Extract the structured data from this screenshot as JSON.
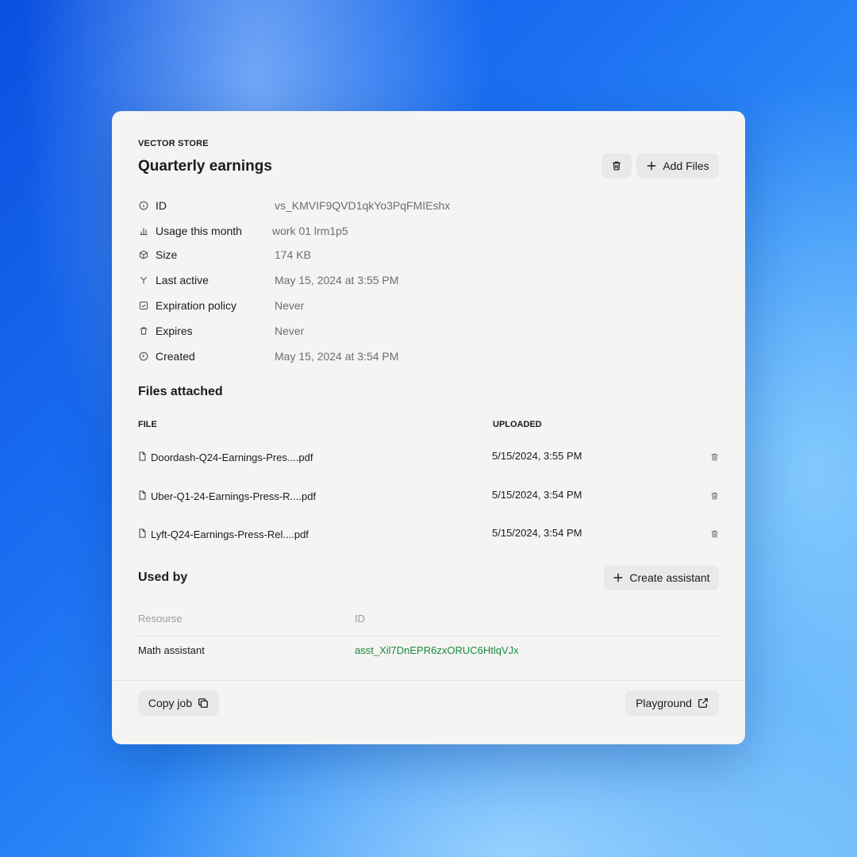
{
  "header": {
    "eyebrow": "VECTOR STORE",
    "title": "Quarterly earnings",
    "add_files_label": "Add Files"
  },
  "meta": [
    {
      "icon": "info-icon",
      "label": "ID",
      "value": "vs_KMVIF9QVD1qkYo3PqFMIEshx"
    },
    {
      "icon": "chart-icon",
      "label": "Usage this month",
      "value": "work 01 lrm1p5"
    },
    {
      "icon": "cube-icon",
      "label": "Size",
      "value": "174 KB"
    },
    {
      "icon": "activity-icon",
      "label": "Last active",
      "value": "May 15, 2024 at 3:55 PM"
    },
    {
      "icon": "calendar-check-icon",
      "label": "Expiration policy",
      "value": "Never"
    },
    {
      "icon": "trash-icon",
      "label": "Expires",
      "value": "Never"
    },
    {
      "icon": "clock-icon",
      "label": "Created",
      "value": "May 15, 2024 at 3:54 PM"
    }
  ],
  "files": {
    "title": "Files attached",
    "col_file": "FILE",
    "col_uploaded": "UPLOADED",
    "rows": [
      {
        "name": "Doordash-Q24-Earnings-Pres....pdf",
        "uploaded": "5/15/2024, 3:55 PM"
      },
      {
        "name": "Uber-Q1-24-Earnings-Press-R....pdf",
        "uploaded": "5/15/2024, 3:54 PM"
      },
      {
        "name": "Lyft-Q24-Earnings-Press-Rel....pdf",
        "uploaded": "5/15/2024, 3:54 PM"
      }
    ]
  },
  "used_by": {
    "title": "Used by",
    "create_label": "Create assistant",
    "col_resource": "Resourse",
    "col_id": "ID",
    "rows": [
      {
        "name": "Math assistant",
        "id": "asst_Xil7DnEPR6zxORUC6HtlqVJx"
      }
    ]
  },
  "footer": {
    "copy_label": "Copy job",
    "playground_label": "Playground"
  },
  "colors": {
    "link_green": "#1a8a3e",
    "card_bg": "#f4f4f3",
    "button_bg": "#e9e9e8"
  }
}
